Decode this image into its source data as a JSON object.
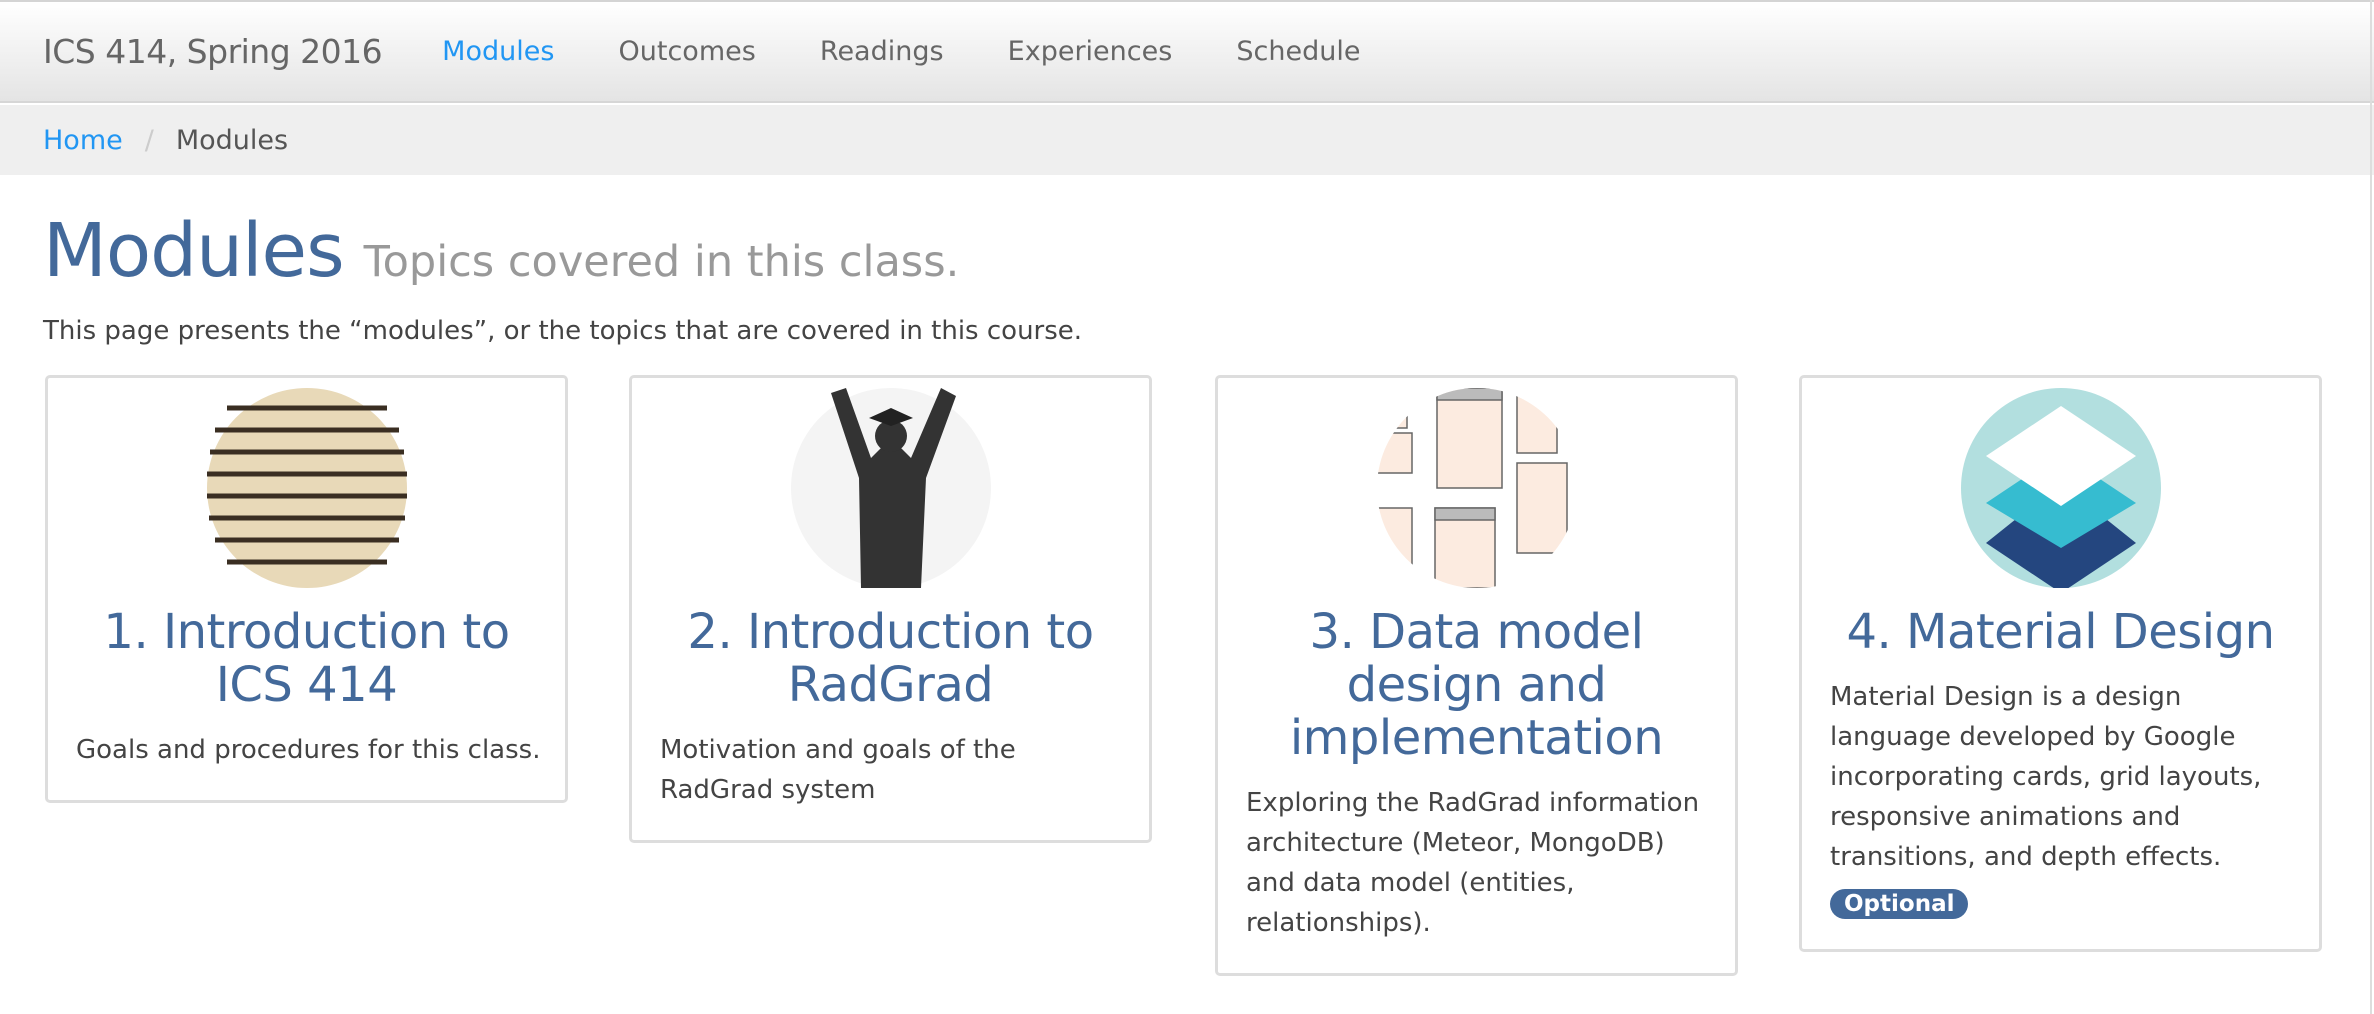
{
  "navbar": {
    "brand": "ICS 414, Spring 2016",
    "items": [
      {
        "label": "Modules",
        "active": true
      },
      {
        "label": "Outcomes"
      },
      {
        "label": "Readings"
      },
      {
        "label": "Experiences"
      },
      {
        "label": "Schedule"
      }
    ]
  },
  "breadcrumb": {
    "home": "Home",
    "separator": "/",
    "current": "Modules"
  },
  "page": {
    "title": "Modules",
    "subtitle": "Topics covered in this class.",
    "intro": "This page presents the “modules”, or the topics that are covered in this course."
  },
  "colors": {
    "accent": "#2196f3",
    "title": "#43699a"
  },
  "cards": [
    {
      "title": "1. Introduction to ICS 414",
      "description": "Goals and procedures for this class.",
      "image": "dictionary-introduction"
    },
    {
      "title": "2. Introduction to RadGrad",
      "description": "Motivation and goals of the RadGrad system",
      "image": "graduate-silhouette"
    },
    {
      "title": "3. Data model design and implementation",
      "description": "Exploring the RadGrad information architecture (Meteor, MongoDB) and data model (entities, relationships).",
      "image": "er-diagram"
    },
    {
      "title": "4. Material Design",
      "description": "Material Design is a design language developed by Google incorporating cards, grid layouts, responsive animations and transitions, and depth effects.",
      "badge": "Optional",
      "image": "material-design-logo"
    }
  ]
}
